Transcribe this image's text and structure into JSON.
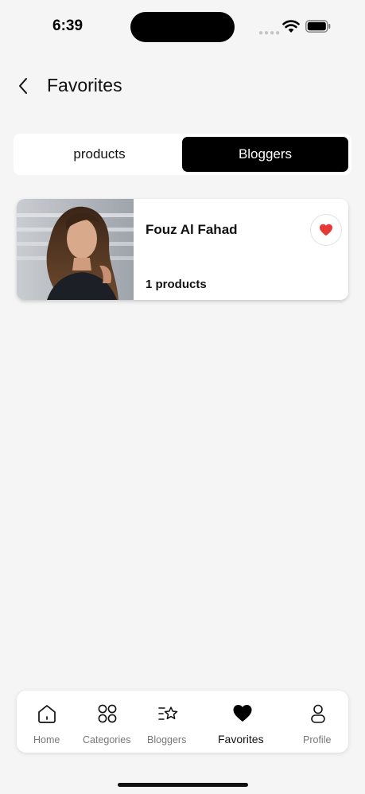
{
  "status_bar": {
    "time": "6:39",
    "icons": [
      "signal-dots-icon",
      "wifi-icon",
      "battery-icon"
    ]
  },
  "header": {
    "back_icon": "chevron-left-icon",
    "title": "Favorites"
  },
  "segmented_tabs": {
    "tabs": [
      {
        "label": "products",
        "active": false
      },
      {
        "label": "Bloggers",
        "active": true
      }
    ],
    "active_color": "#000000"
  },
  "favorites": [
    {
      "name": "Fouz Al Fahad",
      "products": "1 products",
      "favorited": true,
      "heart_color": "#e53935"
    }
  ],
  "bottom_nav": {
    "items": [
      {
        "label": "Home",
        "icon": "home-icon",
        "active": false
      },
      {
        "label": "Categories",
        "icon": "grid-icon",
        "active": false
      },
      {
        "label": "Bloggers",
        "icon": "star-list-icon",
        "active": false
      },
      {
        "label": "Favorites",
        "icon": "heart-icon",
        "active": true
      },
      {
        "label": "Profile",
        "icon": "person-icon",
        "active": false
      }
    ]
  }
}
